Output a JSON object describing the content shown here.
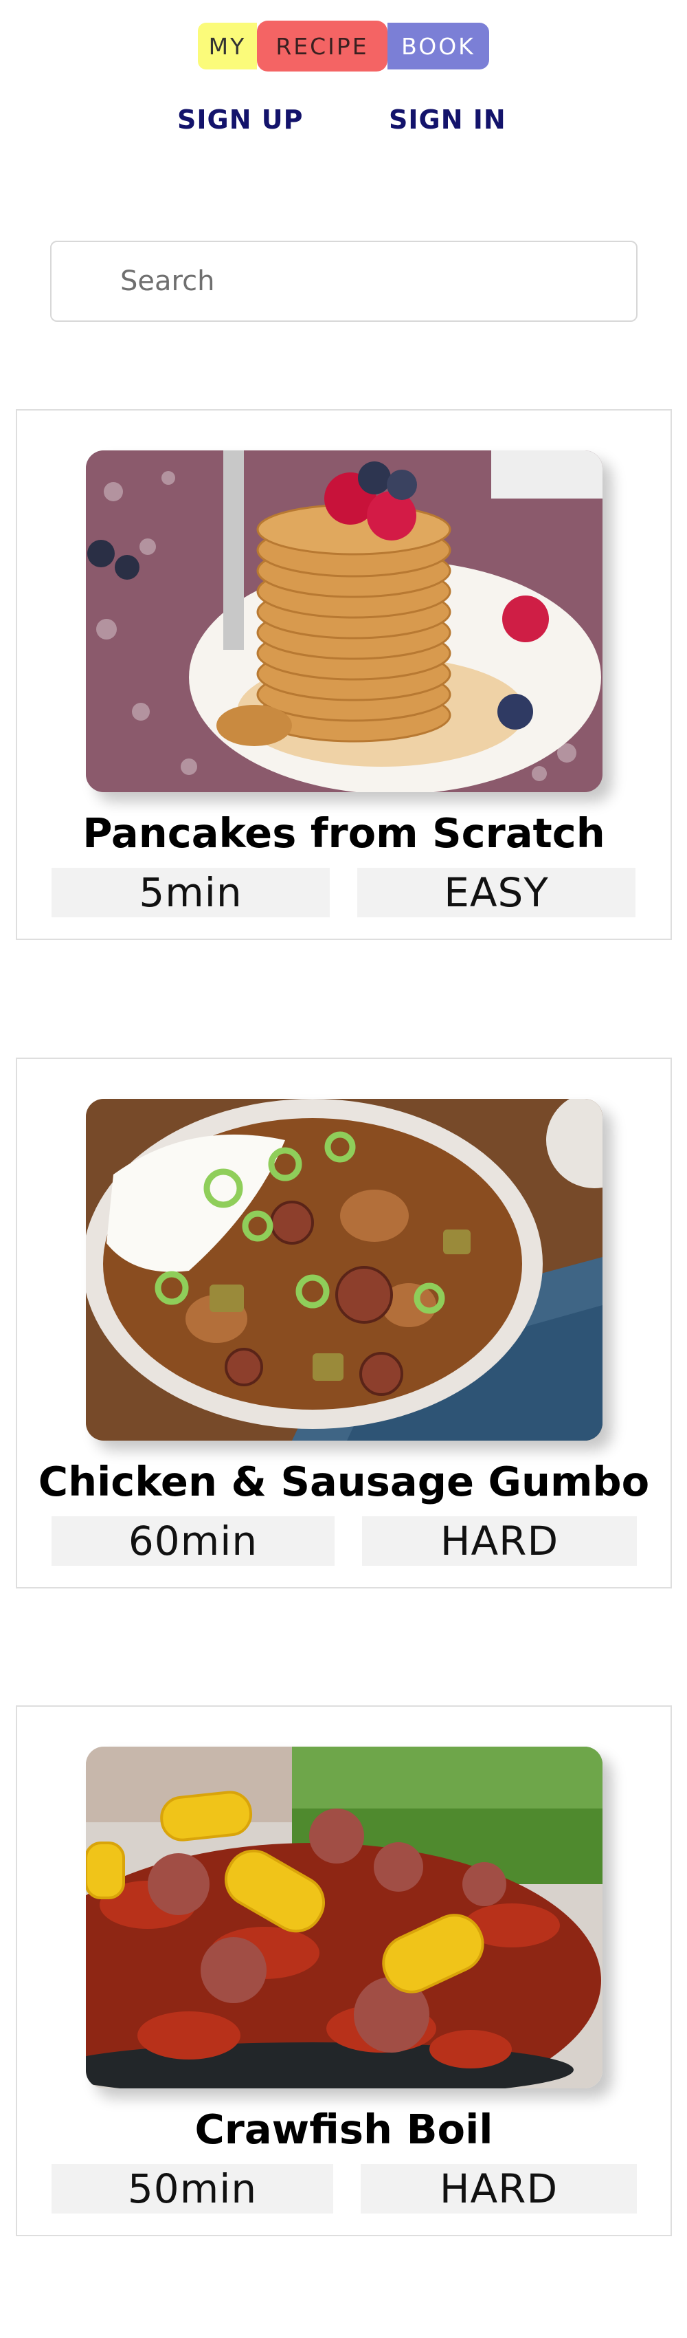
{
  "logo": {
    "part1": "MY",
    "part2": "RECIPE",
    "part3": "BOOK"
  },
  "auth": {
    "signup_label": "SIGN UP",
    "signin_label": "SIGN IN"
  },
  "search": {
    "placeholder": "Search",
    "value": ""
  },
  "recipes": [
    {
      "title": "Pancakes from Scratch",
      "time": "5min",
      "difficulty": "EASY",
      "image": "pancakes-photo"
    },
    {
      "title": "Chicken & Sausage Gumbo",
      "time": "60min",
      "difficulty": "HARD",
      "image": "gumbo-photo"
    },
    {
      "title": "Crawfish Boil",
      "time": "50min",
      "difficulty": "HARD",
      "image": "crawfish-boil-photo"
    }
  ],
  "colors": {
    "logo_my": "#fbfb7a",
    "logo_recipe": "#f46464",
    "logo_book": "#7b7fd6",
    "auth_link": "#13136b",
    "meta_bg": "#f2f2f2"
  }
}
